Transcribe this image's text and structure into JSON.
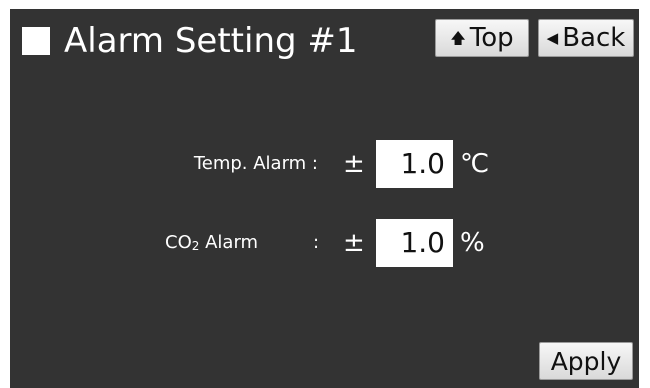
{
  "header": {
    "title": "Alarm Setting #1",
    "top_label": "Top",
    "top_icon": "up-arrow-icon",
    "back_label": "Back",
    "back_icon": "left-triangle-icon"
  },
  "settings": {
    "temp": {
      "label": "Temp. Alarm :",
      "prefix": "±",
      "value": "1.0",
      "unit": "℃"
    },
    "co2": {
      "label_main": "CO",
      "label_sub": "2",
      "label_rest": " Alarm",
      "colon": ":",
      "prefix": "±",
      "value": "1.0",
      "unit": "%"
    }
  },
  "footer": {
    "apply_label": "Apply"
  },
  "colors": {
    "screen_background": "#333333",
    "text": "#ffffff",
    "button_background": "#e8e8e8",
    "value_background": "#ffffff"
  }
}
